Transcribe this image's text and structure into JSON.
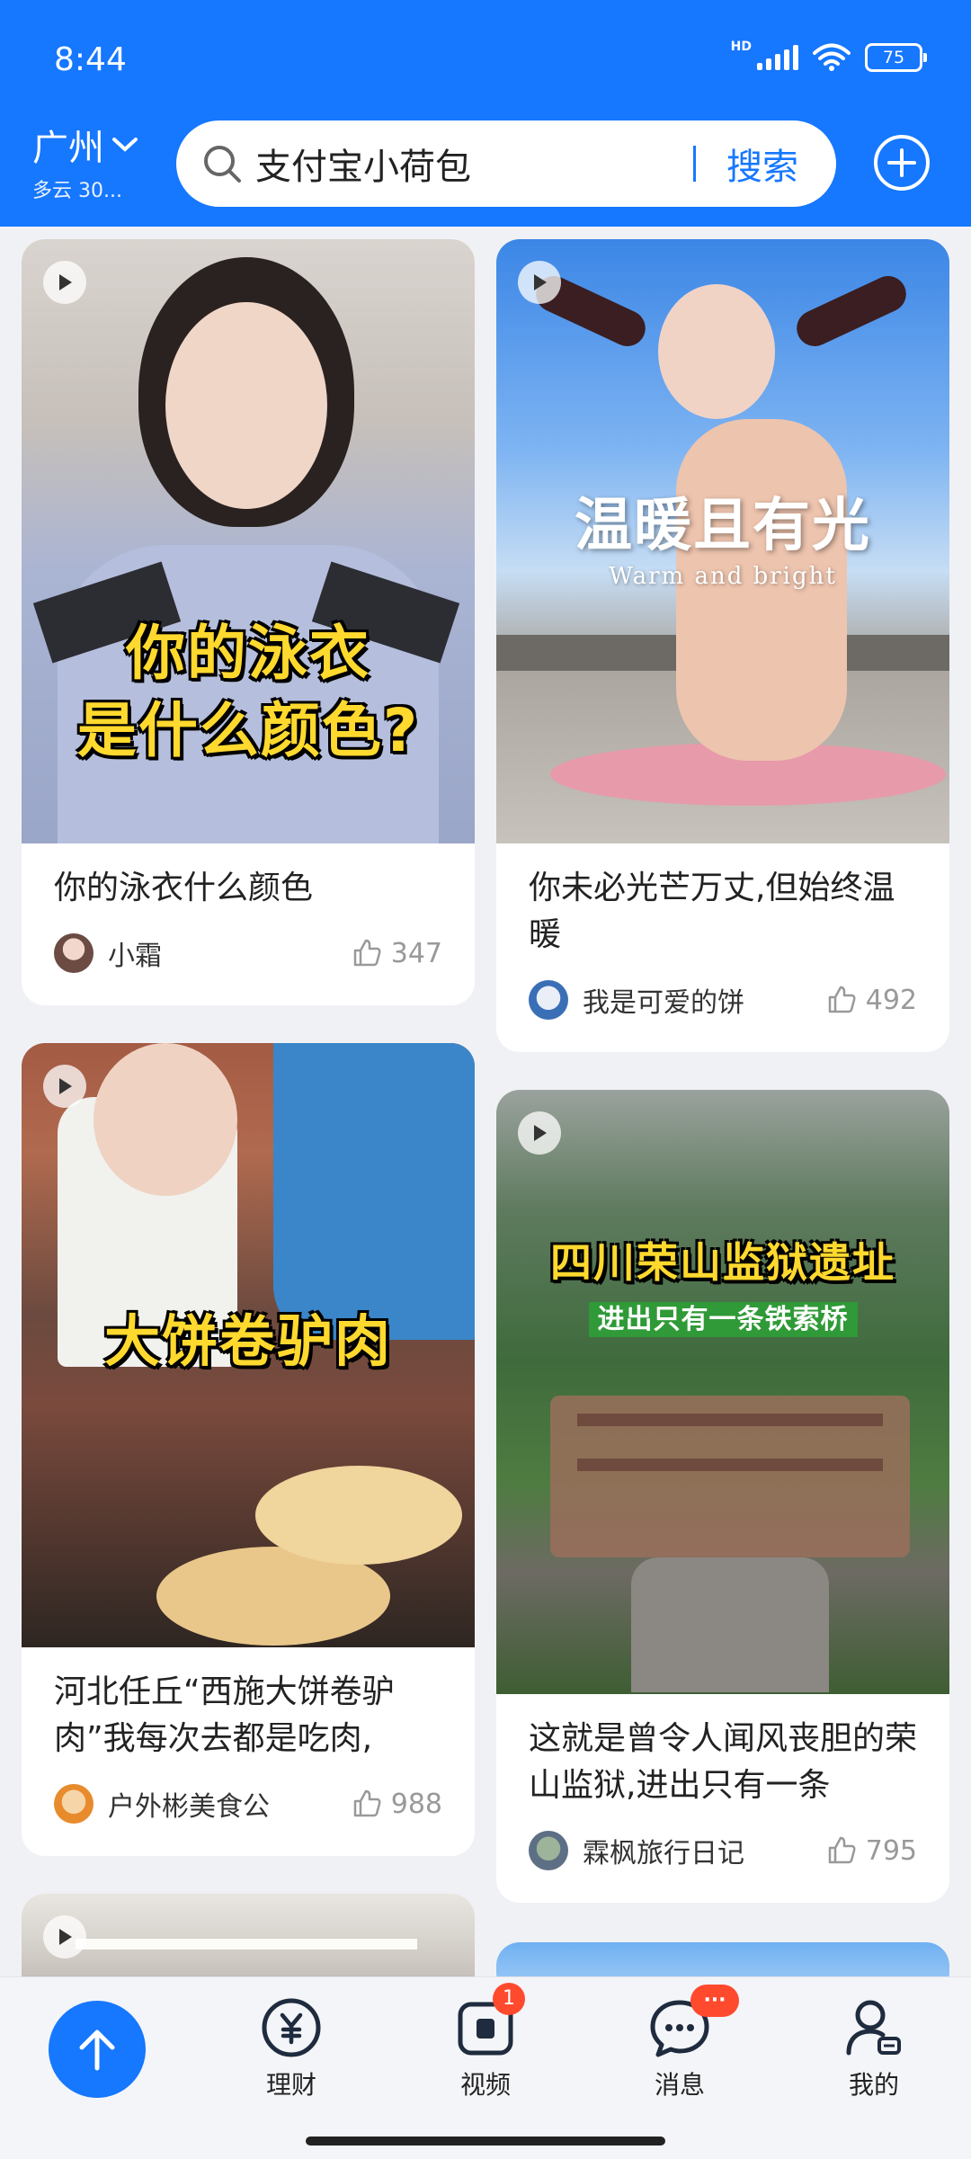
{
  "status_bar": {
    "time": "8:44",
    "network": "HD",
    "battery": "75"
  },
  "header": {
    "city": "广州",
    "weather": "多云 30...",
    "search_text": "支付宝小荷包",
    "search_button": "搜索",
    "accent_color": "#1677ff"
  },
  "feed": {
    "left": [
      {
        "overlay_line1": "你的泳衣",
        "overlay_line2": "是什么颜色?",
        "title": "你的泳衣什么颜色",
        "author": "小霜",
        "likes": "347"
      },
      {
        "overlay_line1": "大饼卷驴肉",
        "title": "河北任丘“西施大饼卷驴肉”我每次去都是吃肉,",
        "author": "户外彬美食公",
        "likes": "988"
      }
    ],
    "right": [
      {
        "overlay_line1": "温暖且有光",
        "overlay_line2": "Warm and bright",
        "title": "你未必光芒万丈,但始终温暖",
        "author": "我是可爱的饼",
        "likes": "492"
      },
      {
        "overlay_line1": "四川荣山监狱遗址",
        "overlay_line2": "进出只有一条铁索桥",
        "title": "这就是曾令人闻风丧胆的荣山监狱,进出只有一条",
        "author": "霖枫旅行日记",
        "likes": "795"
      }
    ]
  },
  "bottom_nav": {
    "items": [
      {
        "label": "理财",
        "icon": "yuan-icon"
      },
      {
        "label": "视频",
        "icon": "video-icon",
        "badge": "1"
      },
      {
        "label": "消息",
        "icon": "message-icon",
        "badge": "···"
      },
      {
        "label": "我的",
        "icon": "profile-icon"
      }
    ]
  }
}
